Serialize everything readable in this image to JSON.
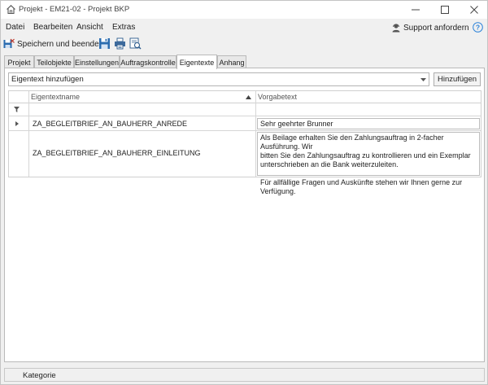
{
  "window": {
    "title": "Projekt - EM21-02 - Projekt BKP"
  },
  "menu": {
    "items": [
      "Datei",
      "Bearbeiten",
      "Ansicht",
      "Extras"
    ]
  },
  "support": {
    "label": "Support anfordern"
  },
  "toolbar": {
    "save_end_label": "Speichern und beenden"
  },
  "tabs": [
    {
      "label": "Projekt",
      "active": false
    },
    {
      "label": "Teilobjekte",
      "active": false
    },
    {
      "label": "Einstellungen",
      "active": false
    },
    {
      "label": "Auftragskontrolle",
      "active": false
    },
    {
      "label": "Eigentexte",
      "active": true
    },
    {
      "label": "Anhang",
      "active": false
    }
  ],
  "eigentext": {
    "combo_value": "Eigentext hinzufügen",
    "add_label": "Hinzufügen"
  },
  "grid": {
    "columns": [
      "Eigentextname",
      "Vorgabetext"
    ],
    "rows": [
      {
        "name": "ZA_BEGLEITBRIEF_AN_BAUHERR_ANREDE",
        "text": [
          "Sehr geehrter Brunner"
        ]
      },
      {
        "name": "ZA_BEGLEITBRIEF_AN_BAUHERR_EINLEITUNG",
        "text": [
          "Als Beilage erhalten Sie den Zahlungsauftrag in 2-facher Ausführung. Wir",
          "bitten Sie den Zahlungsauftrag zu kontrollieren und ein Exemplar",
          "unterschrieben an die Bank weiterzuleiten.",
          "",
          "Für allfällige Fragen und Auskünfte stehen wir Ihnen gerne zur Verfügung."
        ]
      }
    ]
  },
  "status": {
    "label": "Kategorie"
  },
  "colors": {
    "accent_blue": "#2b6cb0",
    "border": "#b9b9b9",
    "panel_bg": "#f0f0f0"
  }
}
